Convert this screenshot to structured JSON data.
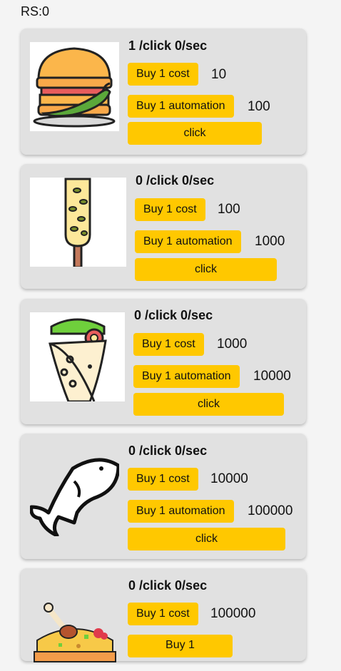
{
  "header": {
    "rs_label": "RS:0"
  },
  "items": [
    {
      "icon": "burger-icon",
      "stat": "1 /click 0/sec",
      "buy_cost_label": "Buy 1 cost",
      "cost": "10",
      "buy_automation_label": "Buy 1 automation",
      "automation_cost": "100",
      "click_label": "click"
    },
    {
      "icon": "corn-icon",
      "stat": "0 /click 0/sec",
      "buy_cost_label": "Buy 1 cost",
      "cost": "100",
      "buy_automation_label": "Buy 1 automation",
      "automation_cost": "1000",
      "click_label": "click"
    },
    {
      "icon": "wrap-icon",
      "stat": "0 /click 0/sec",
      "buy_cost_label": "Buy 1 cost",
      "cost": "1000",
      "buy_automation_label": "Buy 1 automation",
      "automation_cost": "10000",
      "click_label": "click"
    },
    {
      "icon": "fish-icon",
      "stat": "0 /click 0/sec",
      "buy_cost_label": "Buy 1 cost",
      "cost": "10000",
      "buy_automation_label": "Buy 1 automation",
      "automation_cost": "100000",
      "click_label": "click"
    },
    {
      "icon": "chicken-rice-icon",
      "stat": "0 /click 0/sec",
      "buy_cost_label": "Buy 1 cost",
      "cost": "100000",
      "buy_automation_label": "Buy 1"
    }
  ]
}
